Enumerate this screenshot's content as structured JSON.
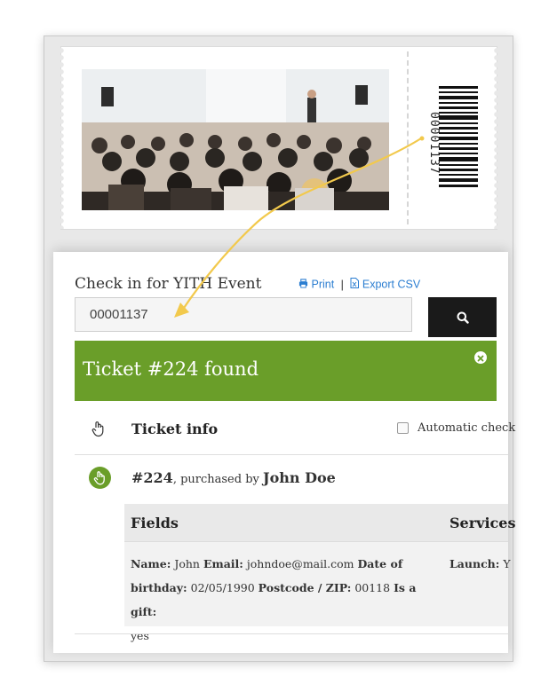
{
  "ticket": {
    "barcode_number": "00001137"
  },
  "checkin": {
    "title": "Check in for YITH Event",
    "print_label": "Print",
    "export_label": "Export CSV",
    "separator": "|",
    "search_value": "00001137"
  },
  "alert": {
    "message": "Ticket #224 found"
  },
  "table": {
    "header": "Ticket info",
    "auto_checkin_label": "Automatic check"
  },
  "ticket_row": {
    "number": "#224",
    "purchased_by": ", purchased by ",
    "buyer": "John Doe"
  },
  "details": {
    "fields_header": "Fields",
    "services_header": "Services",
    "name_label": "Name:",
    "name_value": "John",
    "email_label": "Email:",
    "email_value": "johndoe@mail.com",
    "dob_label": "Date of birthday:",
    "dob_value": "02/05/1990",
    "postcode_label": "Postcode / ZIP:",
    "postcode_value": "00118",
    "gift_label": "Is a gift:",
    "gift_value": "yes",
    "launch_label": "Launch:",
    "launch_value": "Y"
  },
  "colors": {
    "accent_green": "#6a9e29",
    "link_blue": "#2a7dd1",
    "arrow_yellow": "#f2c94c"
  }
}
